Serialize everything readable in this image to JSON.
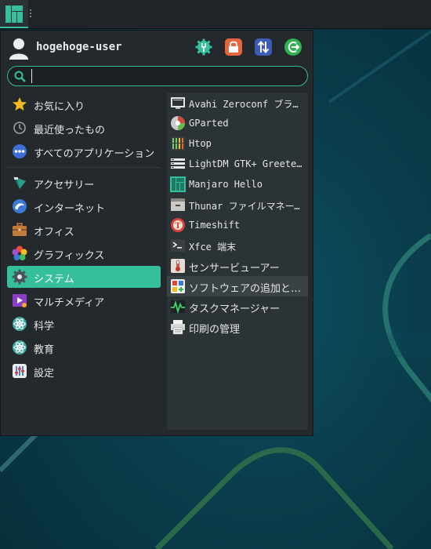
{
  "desktop": {
    "panel": {
      "menu_button": "menu-launcher"
    },
    "colors": {
      "accent": "#35bf9b",
      "panel": "#1e2428",
      "menu_bg": "#23292d",
      "list_bg": "#2c3337",
      "wallpaper": "#0a3d4c"
    }
  },
  "user": {
    "name": "hogehoge-user"
  },
  "actions": [
    {
      "name": "settings",
      "icon": "settings-icon"
    },
    {
      "name": "lock",
      "icon": "lock-icon"
    },
    {
      "name": "switch-user",
      "icon": "switch-user-icon"
    },
    {
      "name": "logout",
      "icon": "logout-icon"
    }
  ],
  "search": {
    "value": "",
    "placeholder": ""
  },
  "categories": [
    {
      "label": "お気に入り",
      "icon": "star-icon",
      "active": false
    },
    {
      "label": "最近使ったもの",
      "icon": "clock-icon",
      "active": false
    },
    {
      "label": "すべてのアプリケーション",
      "icon": "apps-icon",
      "active": false
    },
    {
      "label": "アクセサリー",
      "icon": "accessories-icon",
      "active": false
    },
    {
      "label": "インターネット",
      "icon": "internet-icon",
      "active": false
    },
    {
      "label": "オフィス",
      "icon": "briefcase-icon",
      "active": false
    },
    {
      "label": "グラフィックス",
      "icon": "graphics-icon",
      "active": false
    },
    {
      "label": "システム",
      "icon": "system-gear-icon",
      "active": true
    },
    {
      "label": "マルチメディア",
      "icon": "multimedia-icon",
      "active": false
    },
    {
      "label": "科学",
      "icon": "science-icon",
      "active": false
    },
    {
      "label": "教育",
      "icon": "education-icon",
      "active": false
    },
    {
      "label": "設定",
      "icon": "settings-panel-icon",
      "active": false
    }
  ],
  "apps": [
    {
      "label": "Avahi Zeroconf ブラウザー",
      "icon": "network-browser-icon"
    },
    {
      "label": "GParted",
      "icon": "gparted-icon"
    },
    {
      "label": "Htop",
      "icon": "htop-icon"
    },
    {
      "label": "LightDM GTK+ Greeter settings",
      "icon": "lightdm-icon"
    },
    {
      "label": "Manjaro Hello",
      "icon": "manjaro-icon"
    },
    {
      "label": "Thunar ファイルマネージャー",
      "icon": "file-manager-icon"
    },
    {
      "label": "Timeshift",
      "icon": "timeshift-icon"
    },
    {
      "label": "Xfce 端末",
      "icon": "terminal-icon"
    },
    {
      "label": "センサービューアー",
      "icon": "thermometer-icon"
    },
    {
      "label": "ソフトウェアの追加と削除",
      "icon": "software-icon",
      "hover": true
    },
    {
      "label": "タスクマネージャー",
      "icon": "task-manager-icon"
    },
    {
      "label": "印刷の管理",
      "icon": "printer-icon"
    }
  ]
}
